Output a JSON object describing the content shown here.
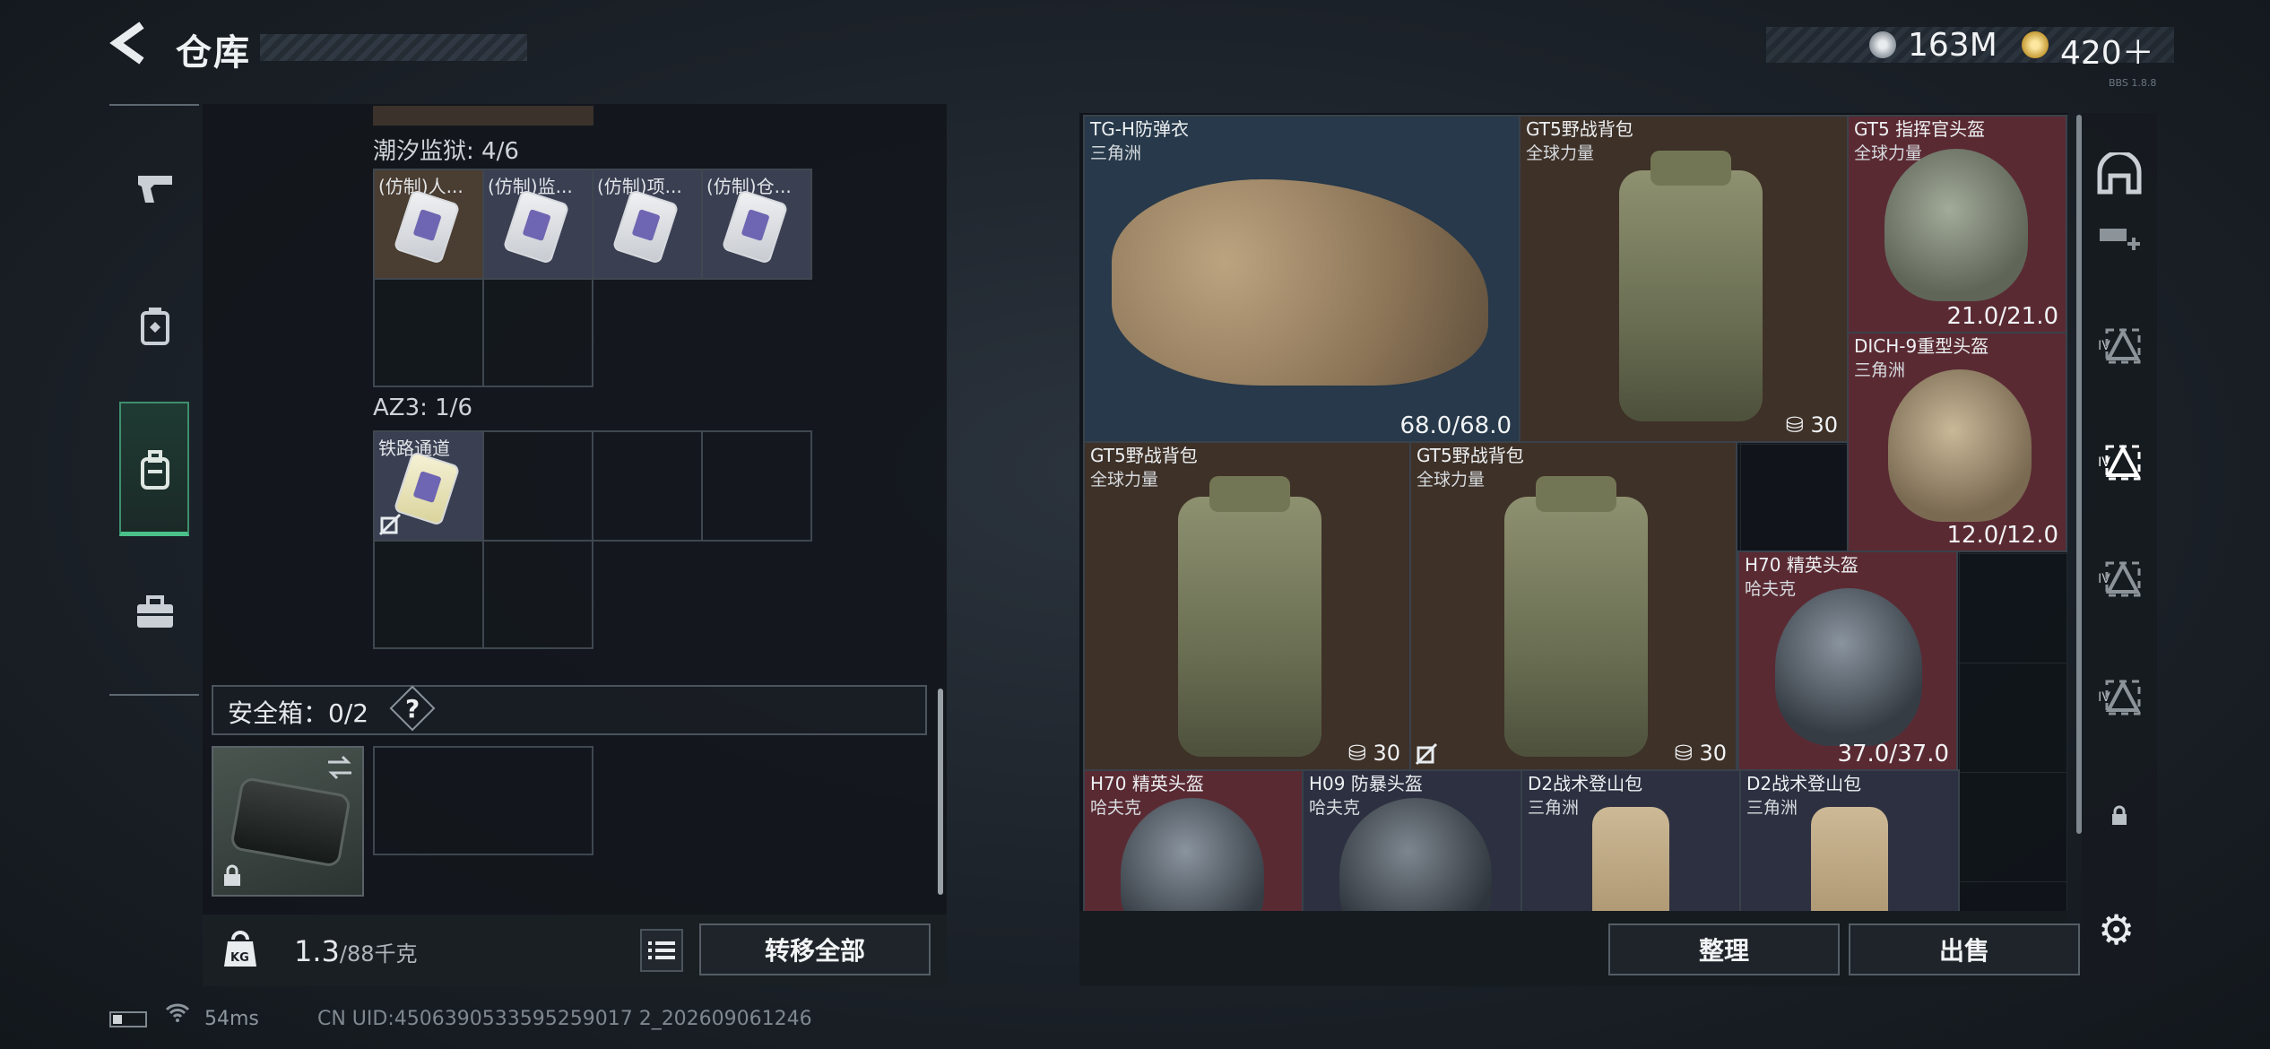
{
  "header": {
    "back_icon": "back-chevron-icon",
    "title": "仓库",
    "currency1_icon": "silver-coin-icon",
    "currency1_value": "163M",
    "currency2_icon": "gold-coin-icon",
    "currency2_value": "420＋",
    "version_tag": "BBS 1.8.8"
  },
  "left_rail": {
    "items": [
      {
        "name": "weapon",
        "icon": "pistol-icon"
      },
      {
        "name": "equipment",
        "icon": "armor-icon"
      },
      {
        "name": "backpack",
        "icon": "backpack-icon"
      },
      {
        "name": "toolbox",
        "icon": "briefcase-icon"
      }
    ],
    "active": "backpack"
  },
  "left_panel": {
    "section1_label": "潮汐监狱: 4/6",
    "section1_items": [
      "(仿制)人...",
      "(仿制)监...",
      "(仿制)项...",
      "(仿制)仓..."
    ],
    "section2_label": "AZ3: 1/6",
    "section2_items": [
      "铁路通道"
    ],
    "safe_label": "安全箱：0/2",
    "safe_help": "?",
    "weight_value": "1.3",
    "weight_max": "/88千克",
    "transfer_label": "转移全部"
  },
  "grid": {
    "items": [
      {
        "name": "TG-H防弹衣",
        "sub": "三角洲",
        "durability": "68.0/68.0"
      },
      {
        "name": "GT5野战背包",
        "sub": "全球力量",
        "capacity": "30"
      },
      {
        "name": "GT5 指挥官头盔",
        "sub": "全球力量",
        "durability": "21.0/21.0"
      },
      {
        "name": "DICH-9重型头盔",
        "sub": "三角洲",
        "durability": "12.0/12.0"
      },
      {
        "name": "GT5野战背包",
        "sub": "全球力量",
        "capacity": "30"
      },
      {
        "name": "GT5野战背包",
        "sub": "全球力量",
        "capacity": "30"
      },
      {
        "name": "H70 精英头盔",
        "sub": "哈夫克",
        "durability": "37.0/37.0"
      },
      {
        "name": "H70 精英头盔",
        "sub": "哈夫克"
      },
      {
        "name": "H09 防暴头盔",
        "sub": "哈夫克"
      },
      {
        "name": "D2战术登山包",
        "sub": "三角洲"
      },
      {
        "name": "D2战术登山包",
        "sub": "三角洲"
      }
    ],
    "sort_label": "整理",
    "sell_label": "出售"
  },
  "right_rail": {
    "tier_labels": [
      "IV",
      "IV",
      "IV",
      "IV"
    ]
  },
  "status": {
    "ping": "54ms",
    "uid": "CN UID:4506390533595259017 2_202609061246"
  },
  "colors": {
    "accent_green": "#4ac08a",
    "slot_red": "#5a2a33",
    "slot_brown": "#3e3128",
    "slot_blue": "#27394a"
  }
}
